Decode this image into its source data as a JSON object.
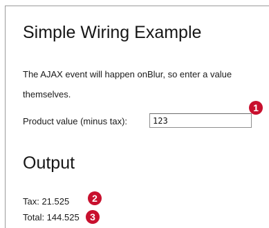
{
  "header": {
    "title": "Simple Wiring Example"
  },
  "intro": {
    "line1": "The AJAX event will happen onBlur, so enter a value",
    "line2": "themselves."
  },
  "form": {
    "label": "Product value (minus tax):",
    "value": "123"
  },
  "output": {
    "title": "Output",
    "tax": "Tax: 21.525",
    "total": "Total: 144.525"
  },
  "callouts": {
    "one": "1",
    "two": "2",
    "three": "3",
    "color": "#c8102e"
  }
}
